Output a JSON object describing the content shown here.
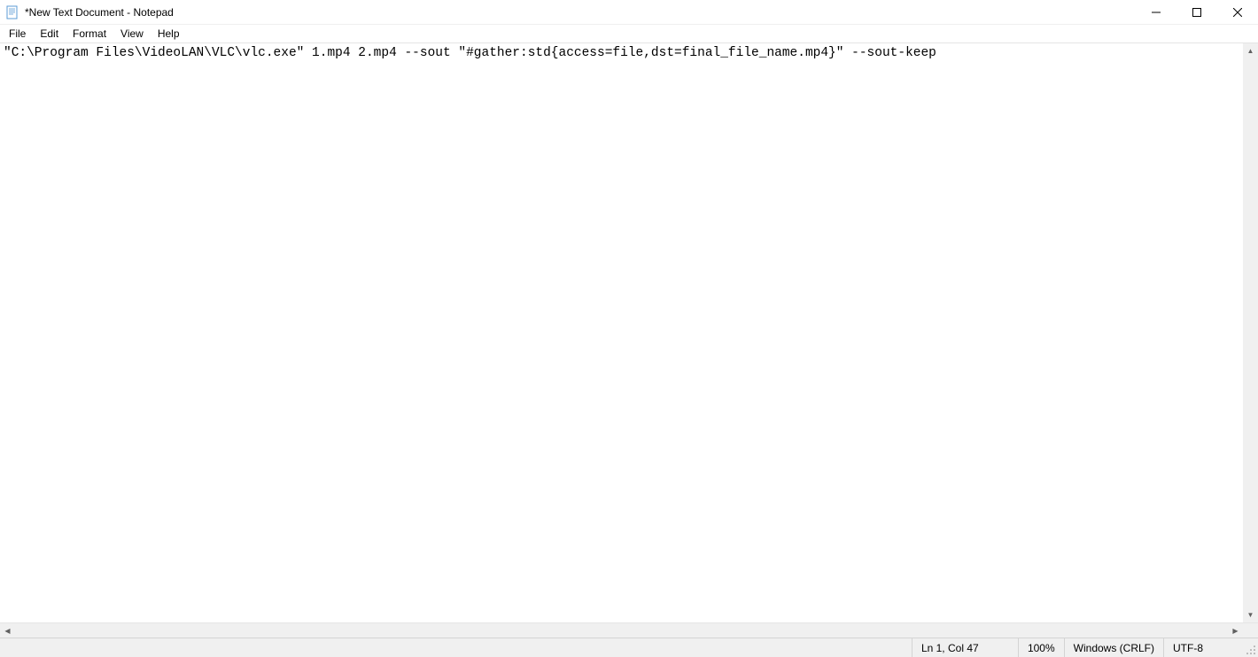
{
  "titlebar": {
    "title": "*New Text Document - Notepad"
  },
  "menubar": {
    "file": "File",
    "edit": "Edit",
    "format": "Format",
    "view": "View",
    "help": "Help"
  },
  "editor": {
    "content": "\"C:\\Program Files\\VideoLAN\\VLC\\vlc.exe\" 1.mp4 2.mp4 --sout \"#gather:std{access=file,dst=final_file_name.mp4}\" --sout-keep"
  },
  "statusbar": {
    "position": "Ln 1, Col 47",
    "zoom": "100%",
    "line_ending": "Windows (CRLF)",
    "encoding": "UTF-8"
  }
}
